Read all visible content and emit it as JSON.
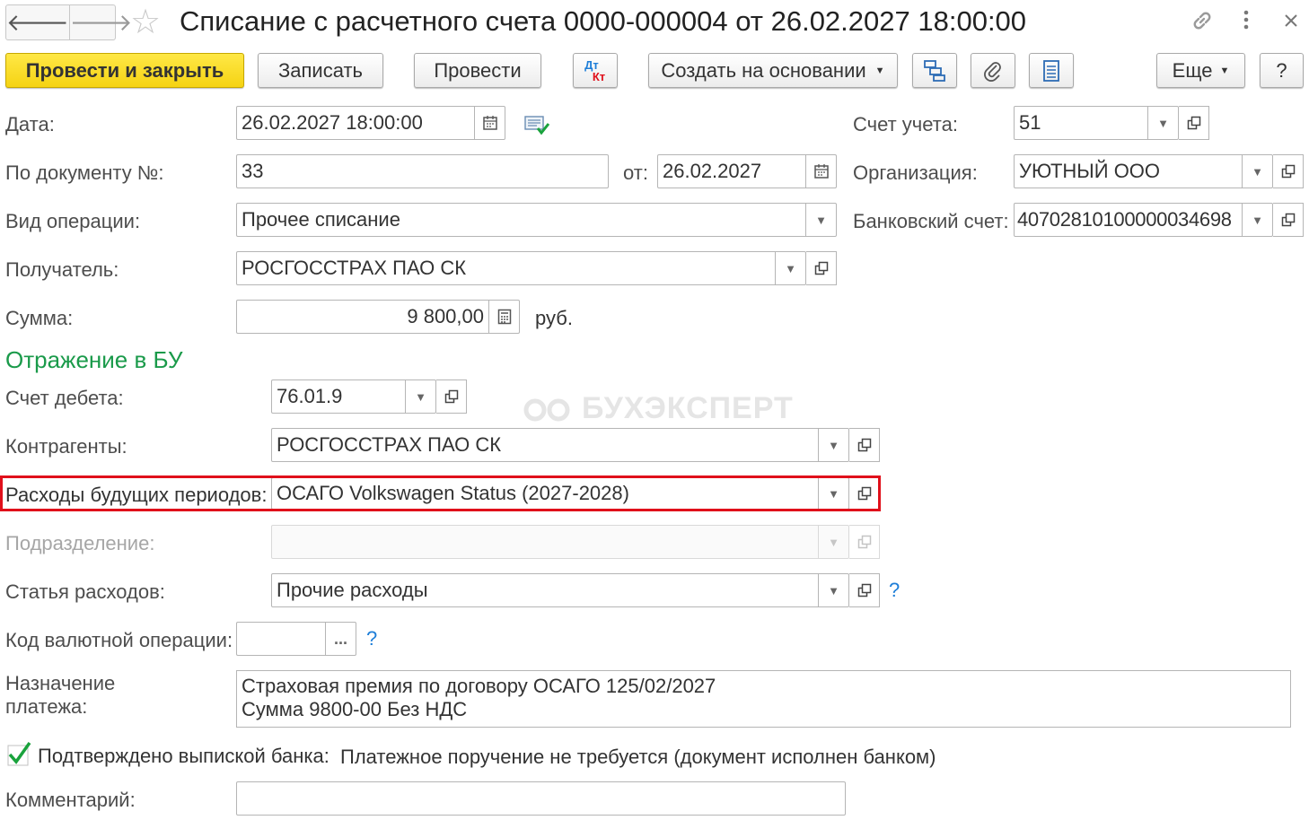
{
  "window": {
    "title": "Списание с расчетного счета 0000-000004 от 26.02.2027 18:00:00",
    "nav_back": "🡐",
    "nav_forward": "🡒",
    "star": "☆",
    "link_icon": "🔗",
    "menu_icon": "⋮",
    "close_icon": "✕"
  },
  "toolbar": {
    "post_close": "Провести и закрыть",
    "save": "Записать",
    "post": "Провести",
    "dt": "Дт",
    "kt": "Кт",
    "create_based": "Создать на основании",
    "more": "Еще",
    "help": "?"
  },
  "form": {
    "date_label": "Дата:",
    "date_value": "26.02.2027 18:00:00",
    "doc_no_label": "По документу №:",
    "doc_no_value": "33",
    "doc_from_label": "от:",
    "doc_from_value": "26.02.2027",
    "op_type_label": "Вид операции:",
    "op_type_value": "Прочее списание",
    "recipient_label": "Получатель:",
    "recipient_value": "РОСГОССТРАХ ПАО СК",
    "amount_label": "Сумма:",
    "amount_value": "9 800,00",
    "currency": "руб.",
    "account_label": "Счет учета:",
    "account_value": "51",
    "org_label": "Организация:",
    "org_value": "УЮТНЫЙ ООО",
    "bank_account_label": "Банковский счет:",
    "bank_account_value": "40702810100000034698"
  },
  "bu_section": {
    "title": "Отражение в БУ",
    "debit_label": "Счет дебета:",
    "debit_value": "76.01.9",
    "contractors_label": "Контрагенты:",
    "contractors_value": "РОСГОССТРАХ ПАО СК",
    "deferred_label": "Расходы будущих периодов:",
    "deferred_value": "ОСАГО Volkswagen Status (2027-2028)",
    "division_label": "Подразделение:",
    "division_value": "",
    "expense_item_label": "Статья расходов:",
    "expense_item_value": "Прочие расходы",
    "currency_op_label": "Код валютной операции:",
    "currency_op_value": "",
    "ellipsis": "...",
    "q": "?"
  },
  "payment": {
    "label_line1": "Назначение",
    "label_line2": "платежа:",
    "line1": "Страховая премия по договору ОСАГО 125/02/2027",
    "line2": "Сумма 9800-00 Без НДС"
  },
  "confirm": {
    "checked": true,
    "label": "Подтверждено выпиской банка:",
    "note": "Платежное поручение не требуется (документ исполнен банком)"
  },
  "comment": {
    "label": "Комментарий:",
    "value": ""
  },
  "watermark": "БУХЭКСПЕРТ",
  "colors": {
    "primary_button": "#f5d313",
    "section_title": "#1a9a4a",
    "highlight": "#e0101b",
    "help_link": "#1e7ed8"
  }
}
